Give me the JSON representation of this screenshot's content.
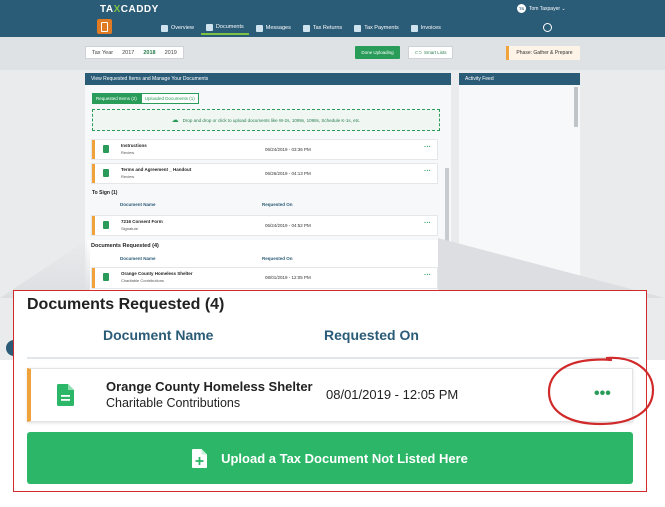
{
  "app": {
    "logo_text": "TAXCADDY",
    "logo_prefix": "TA",
    "logo_accent": "X",
    "logo_suffix": "CADDY",
    "user_initials": "TS",
    "user_name": "Tom Taxpayer ⌄",
    "nav": [
      {
        "label": "Overview",
        "icon": "home-icon"
      },
      {
        "label": "Documents",
        "icon": "documents-icon",
        "active": true
      },
      {
        "label": "Messages",
        "icon": "messages-icon"
      },
      {
        "label": "Tax Returns",
        "icon": "tax-returns-icon"
      },
      {
        "label": "Tax Payments",
        "icon": "tax-payments-icon"
      },
      {
        "label": "Invoices",
        "icon": "invoices-icon"
      }
    ],
    "tax_year_label": "Tax Year",
    "years": [
      "2017",
      "2018",
      "2019"
    ],
    "selected_year": "2018",
    "done_uploading": "Done Uploading",
    "smart_lists": "Smart Lists",
    "phase": "Phase: Gather & Prepare",
    "panel_title": "View Requested Items and Manage Your Documents",
    "activity_title": "Activity Feed",
    "tab_requested": "Requested Items (2)",
    "tab_uploaded": "Uploaded Documents (1)",
    "dropzone_text": "Drop and drop or click to upload documents like W-2s, 1099s, 1098s, Schedule K-1s, etc.",
    "rows": [
      {
        "title": "Instructions",
        "sub": "Review",
        "date": "06/24/2019 - 03:36 PM"
      },
      {
        "title": "Terms and Agreement _ Handout",
        "sub": "Review",
        "date": "06/26/2019 - 04:13 PM"
      }
    ],
    "to_sign_title": "To Sign (1)",
    "col_name_small": "Document Name",
    "col_date_small": "Requested On",
    "sign_row": {
      "title": "7216 Consent Form",
      "sub": "Signature",
      "date": "06/24/2019 - 04:52 PM"
    },
    "req_title_small": "Documents Requested (4)",
    "req_row_small": {
      "title": "Orange County Homeless Shelter",
      "sub": "Charitable Contributions",
      "date": "08/01/2019 - 12:05 PM"
    }
  },
  "callout": {
    "section_title": "Documents Requested (4)",
    "col_document_name": "Document Name",
    "col_requested_on": "Requested On",
    "document": {
      "title": "Orange County Homeless Shelter",
      "category": "Charitable Contributions",
      "requested_on": "08/01/2019 - 12:05 PM",
      "more_label": "•••"
    },
    "upload_button": "Upload a Tax Document Not Listed Here"
  },
  "colors": {
    "brand_blue": "#2a5b77",
    "accent_green": "#2bb767",
    "status_orange": "#f0a23b",
    "highlight_red": "#d12a2a"
  }
}
